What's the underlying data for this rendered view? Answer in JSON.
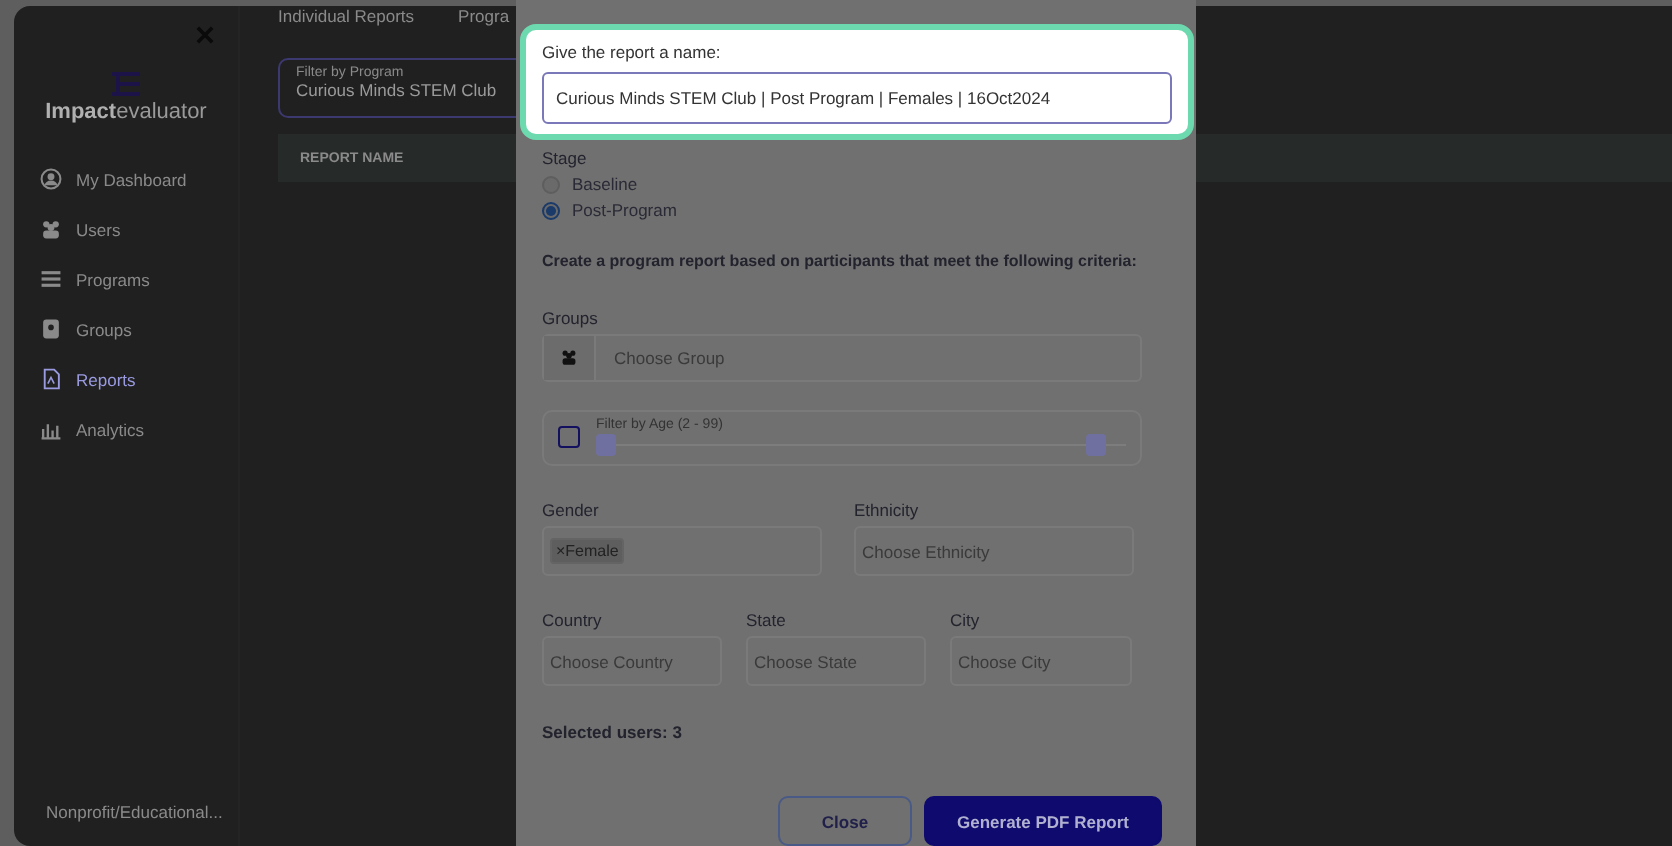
{
  "header_tabs": [
    "Individual Reports",
    "Progra"
  ],
  "sidebar": {
    "logo": {
      "bold": "Impact",
      "light": "evaluator"
    },
    "items": [
      {
        "label": "My Dashboard",
        "selected": false
      },
      {
        "label": "Users",
        "selected": false
      },
      {
        "label": "Programs",
        "selected": false
      },
      {
        "label": "Groups",
        "selected": false
      },
      {
        "label": "Reports",
        "selected": true
      },
      {
        "label": "Analytics",
        "selected": false
      }
    ],
    "footer": "Nonprofit/Educational..."
  },
  "filter": {
    "label": "Filter by Program",
    "value": "Curious Minds STEM Club"
  },
  "table": {
    "columns": [
      "REPORT NAME"
    ]
  },
  "modal": {
    "name_label": "Give the report a name:",
    "name_value": "Curious Minds STEM Club | Post Program | Females | 16Oct2024",
    "stage": {
      "label": "Stage",
      "options": [
        {
          "label": "Baseline",
          "selected": false
        },
        {
          "label": "Post-Program",
          "selected": true
        }
      ]
    },
    "criteria": "Create a program report based on participants that meet the following criteria:",
    "groups": {
      "label": "Groups",
      "placeholder": "Choose Group"
    },
    "age": {
      "label": "Filter by Age (2 - 99)",
      "checked": false,
      "thumbs": [
        {
          "level": 0
        },
        {
          "level": 1
        }
      ]
    },
    "gender": {
      "label": "Gender",
      "chips": [
        {
          "remove": "×",
          "label": "Female"
        }
      ]
    },
    "ethnicity": {
      "label": "Ethnicity",
      "placeholder": "Choose Ethnicity"
    },
    "country": {
      "label": "Country",
      "placeholder": "Choose Country"
    },
    "state": {
      "label": "State",
      "placeholder": "Choose State"
    },
    "city": {
      "label": "City",
      "placeholder": "Choose City"
    },
    "selected_users": "Selected users: 3",
    "buttons": [
      {
        "label": "Close",
        "kind": "secondary"
      },
      {
        "label": "Generate PDF Report",
        "kind": "primary"
      }
    ]
  }
}
